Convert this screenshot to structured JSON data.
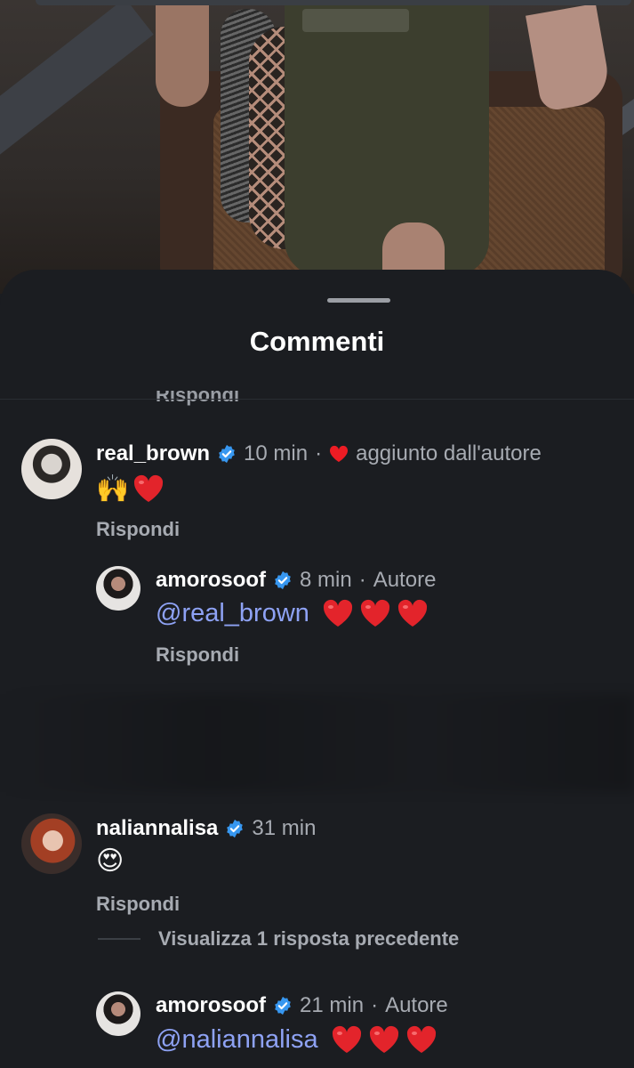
{
  "sheet": {
    "title": "Commenti",
    "cutoff_label": "Rispondi"
  },
  "comments": [
    {
      "username": "real_brown",
      "time": "10 min",
      "liked_by_author": "aggiunto dall'autore",
      "body_emoji": "🙌",
      "reply_label": "Rispondi",
      "replies": [
        {
          "username": "amorosoof",
          "time": "8 min",
          "tag": "Autore",
          "mention": "@real_brown",
          "reply_label": "Rispondi"
        }
      ]
    },
    {
      "username": "naliannalisa",
      "time": "31 min",
      "body_emoji": "😍",
      "reply_label": "Rispondi",
      "view_replies_label": "Visualizza 1 risposta precedente",
      "replies": [
        {
          "username": "amorosoof",
          "time": "21 min",
          "tag": "Autore",
          "mention": "@naliannalisa"
        }
      ]
    }
  ],
  "colors": {
    "background": "#1b1d21",
    "mention": "#8ea2f4",
    "verified": "#3797f0",
    "heart": "#ed1c24",
    "muted": "#a7abb2"
  },
  "icons": [
    "verified-badge-icon",
    "heart-icon",
    "raised-hands-emoji",
    "heart-eyes-emoji"
  ]
}
